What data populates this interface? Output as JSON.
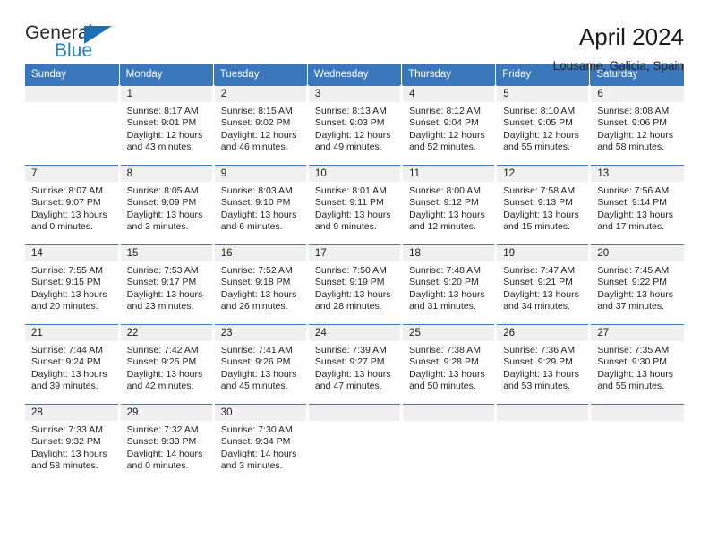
{
  "brand": {
    "name_top": "General",
    "name_bottom": "Blue",
    "accent_color": "#1f7ec4",
    "triangle_color": "#1a6fb5"
  },
  "header": {
    "title": "April 2024",
    "subtitle": "Lousame, Galicia, Spain"
  },
  "theme": {
    "header_bg": "#3b77bc",
    "daynum_bg": "#f0f0f0",
    "text": "#222222"
  },
  "weekdays": [
    "Sunday",
    "Monday",
    "Tuesday",
    "Wednesday",
    "Thursday",
    "Friday",
    "Saturday"
  ],
  "weeks": [
    [
      {
        "day": ""
      },
      {
        "day": "1",
        "sunrise": "Sunrise: 8:17 AM",
        "sunset": "Sunset: 9:01 PM",
        "daylight1": "Daylight: 12 hours",
        "daylight2": "and 43 minutes."
      },
      {
        "day": "2",
        "sunrise": "Sunrise: 8:15 AM",
        "sunset": "Sunset: 9:02 PM",
        "daylight1": "Daylight: 12 hours",
        "daylight2": "and 46 minutes."
      },
      {
        "day": "3",
        "sunrise": "Sunrise: 8:13 AM",
        "sunset": "Sunset: 9:03 PM",
        "daylight1": "Daylight: 12 hours",
        "daylight2": "and 49 minutes."
      },
      {
        "day": "4",
        "sunrise": "Sunrise: 8:12 AM",
        "sunset": "Sunset: 9:04 PM",
        "daylight1": "Daylight: 12 hours",
        "daylight2": "and 52 minutes."
      },
      {
        "day": "5",
        "sunrise": "Sunrise: 8:10 AM",
        "sunset": "Sunset: 9:05 PM",
        "daylight1": "Daylight: 12 hours",
        "daylight2": "and 55 minutes."
      },
      {
        "day": "6",
        "sunrise": "Sunrise: 8:08 AM",
        "sunset": "Sunset: 9:06 PM",
        "daylight1": "Daylight: 12 hours",
        "daylight2": "and 58 minutes."
      }
    ],
    [
      {
        "day": "7",
        "sunrise": "Sunrise: 8:07 AM",
        "sunset": "Sunset: 9:07 PM",
        "daylight1": "Daylight: 13 hours",
        "daylight2": "and 0 minutes."
      },
      {
        "day": "8",
        "sunrise": "Sunrise: 8:05 AM",
        "sunset": "Sunset: 9:09 PM",
        "daylight1": "Daylight: 13 hours",
        "daylight2": "and 3 minutes."
      },
      {
        "day": "9",
        "sunrise": "Sunrise: 8:03 AM",
        "sunset": "Sunset: 9:10 PM",
        "daylight1": "Daylight: 13 hours",
        "daylight2": "and 6 minutes."
      },
      {
        "day": "10",
        "sunrise": "Sunrise: 8:01 AM",
        "sunset": "Sunset: 9:11 PM",
        "daylight1": "Daylight: 13 hours",
        "daylight2": "and 9 minutes."
      },
      {
        "day": "11",
        "sunrise": "Sunrise: 8:00 AM",
        "sunset": "Sunset: 9:12 PM",
        "daylight1": "Daylight: 13 hours",
        "daylight2": "and 12 minutes."
      },
      {
        "day": "12",
        "sunrise": "Sunrise: 7:58 AM",
        "sunset": "Sunset: 9:13 PM",
        "daylight1": "Daylight: 13 hours",
        "daylight2": "and 15 minutes."
      },
      {
        "day": "13",
        "sunrise": "Sunrise: 7:56 AM",
        "sunset": "Sunset: 9:14 PM",
        "daylight1": "Daylight: 13 hours",
        "daylight2": "and 17 minutes."
      }
    ],
    [
      {
        "day": "14",
        "sunrise": "Sunrise: 7:55 AM",
        "sunset": "Sunset: 9:15 PM",
        "daylight1": "Daylight: 13 hours",
        "daylight2": "and 20 minutes."
      },
      {
        "day": "15",
        "sunrise": "Sunrise: 7:53 AM",
        "sunset": "Sunset: 9:17 PM",
        "daylight1": "Daylight: 13 hours",
        "daylight2": "and 23 minutes."
      },
      {
        "day": "16",
        "sunrise": "Sunrise: 7:52 AM",
        "sunset": "Sunset: 9:18 PM",
        "daylight1": "Daylight: 13 hours",
        "daylight2": "and 26 minutes."
      },
      {
        "day": "17",
        "sunrise": "Sunrise: 7:50 AM",
        "sunset": "Sunset: 9:19 PM",
        "daylight1": "Daylight: 13 hours",
        "daylight2": "and 28 minutes."
      },
      {
        "day": "18",
        "sunrise": "Sunrise: 7:48 AM",
        "sunset": "Sunset: 9:20 PM",
        "daylight1": "Daylight: 13 hours",
        "daylight2": "and 31 minutes."
      },
      {
        "day": "19",
        "sunrise": "Sunrise: 7:47 AM",
        "sunset": "Sunset: 9:21 PM",
        "daylight1": "Daylight: 13 hours",
        "daylight2": "and 34 minutes."
      },
      {
        "day": "20",
        "sunrise": "Sunrise: 7:45 AM",
        "sunset": "Sunset: 9:22 PM",
        "daylight1": "Daylight: 13 hours",
        "daylight2": "and 37 minutes."
      }
    ],
    [
      {
        "day": "21",
        "sunrise": "Sunrise: 7:44 AM",
        "sunset": "Sunset: 9:24 PM",
        "daylight1": "Daylight: 13 hours",
        "daylight2": "and 39 minutes."
      },
      {
        "day": "22",
        "sunrise": "Sunrise: 7:42 AM",
        "sunset": "Sunset: 9:25 PM",
        "daylight1": "Daylight: 13 hours",
        "daylight2": "and 42 minutes."
      },
      {
        "day": "23",
        "sunrise": "Sunrise: 7:41 AM",
        "sunset": "Sunset: 9:26 PM",
        "daylight1": "Daylight: 13 hours",
        "daylight2": "and 45 minutes."
      },
      {
        "day": "24",
        "sunrise": "Sunrise: 7:39 AM",
        "sunset": "Sunset: 9:27 PM",
        "daylight1": "Daylight: 13 hours",
        "daylight2": "and 47 minutes."
      },
      {
        "day": "25",
        "sunrise": "Sunrise: 7:38 AM",
        "sunset": "Sunset: 9:28 PM",
        "daylight1": "Daylight: 13 hours",
        "daylight2": "and 50 minutes."
      },
      {
        "day": "26",
        "sunrise": "Sunrise: 7:36 AM",
        "sunset": "Sunset: 9:29 PM",
        "daylight1": "Daylight: 13 hours",
        "daylight2": "and 53 minutes."
      },
      {
        "day": "27",
        "sunrise": "Sunrise: 7:35 AM",
        "sunset": "Sunset: 9:30 PM",
        "daylight1": "Daylight: 13 hours",
        "daylight2": "and 55 minutes."
      }
    ],
    [
      {
        "day": "28",
        "sunrise": "Sunrise: 7:33 AM",
        "sunset": "Sunset: 9:32 PM",
        "daylight1": "Daylight: 13 hours",
        "daylight2": "and 58 minutes."
      },
      {
        "day": "29",
        "sunrise": "Sunrise: 7:32 AM",
        "sunset": "Sunset: 9:33 PM",
        "daylight1": "Daylight: 14 hours",
        "daylight2": "and 0 minutes."
      },
      {
        "day": "30",
        "sunrise": "Sunrise: 7:30 AM",
        "sunset": "Sunset: 9:34 PM",
        "daylight1": "Daylight: 14 hours",
        "daylight2": "and 3 minutes."
      },
      {
        "day": ""
      },
      {
        "day": ""
      },
      {
        "day": ""
      },
      {
        "day": ""
      }
    ]
  ]
}
